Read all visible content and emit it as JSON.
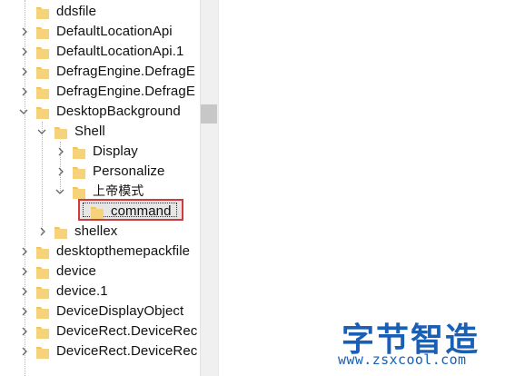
{
  "tree": {
    "nodes": [
      {
        "label": "ddsfile",
        "expander": "none",
        "icon": "folder-icon",
        "state": "normal"
      },
      {
        "label": "DefaultLocationApi",
        "expander": "collapsed",
        "icon": "folder-icon",
        "state": "normal"
      },
      {
        "label": "DefaultLocationApi.1",
        "expander": "collapsed",
        "icon": "folder-icon",
        "state": "normal"
      },
      {
        "label": "DefragEngine.DefragE",
        "expander": "collapsed",
        "icon": "folder-icon",
        "state": "normal"
      },
      {
        "label": "DefragEngine.DefragE",
        "expander": "collapsed",
        "icon": "folder-icon",
        "state": "normal"
      },
      {
        "label": "DesktopBackground",
        "expander": "expanded",
        "icon": "folder-icon",
        "state": "normal"
      },
      {
        "label": "Shell",
        "expander": "expanded",
        "icon": "folder-icon",
        "state": "normal"
      },
      {
        "label": "Display",
        "expander": "collapsed",
        "icon": "folder-icon",
        "state": "normal"
      },
      {
        "label": "Personalize",
        "expander": "collapsed",
        "icon": "folder-icon",
        "state": "normal"
      },
      {
        "label": "上帝模式",
        "expander": "expanded",
        "icon": "folder-icon",
        "state": "normal"
      },
      {
        "label": "command",
        "expander": "none",
        "icon": "folder-icon",
        "state": "selected"
      },
      {
        "label": "shellex",
        "expander": "collapsed",
        "icon": "folder-icon",
        "state": "normal"
      },
      {
        "label": "desktopthemepackfile",
        "expander": "collapsed",
        "icon": "folder-icon",
        "state": "normal"
      },
      {
        "label": "device",
        "expander": "collapsed",
        "icon": "folder-icon",
        "state": "normal"
      },
      {
        "label": "device.1",
        "expander": "collapsed",
        "icon": "folder-icon",
        "state": "normal"
      },
      {
        "label": "DeviceDisplayObject",
        "expander": "collapsed",
        "icon": "folder-icon",
        "state": "normal"
      },
      {
        "label": "DeviceRect.DeviceRec",
        "expander": "collapsed",
        "icon": "folder-icon",
        "state": "normal"
      },
      {
        "label": "DeviceRect.DeviceRec",
        "expander": "collapsed",
        "icon": "folder-icon",
        "state": "normal"
      }
    ]
  },
  "watermark": {
    "title": "字节智造",
    "url": "www.zsxcool.com"
  },
  "colors": {
    "folder": "#f2c55c",
    "folder_dark": "#dca93c",
    "highlight_border": "#cf3b3b",
    "watermark": "#1a5fb6"
  }
}
